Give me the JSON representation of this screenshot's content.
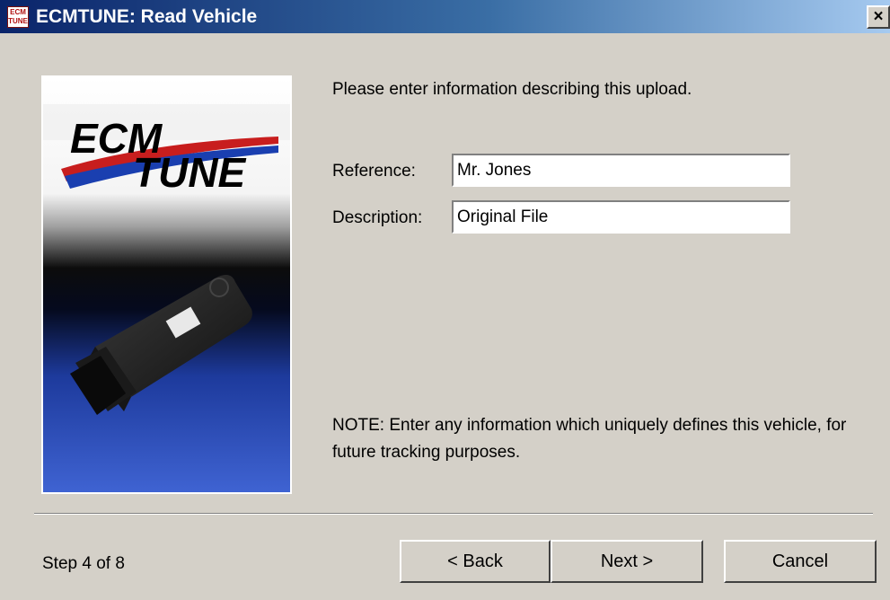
{
  "window": {
    "title": "ECMTUNE: Read Vehicle",
    "icon": "ecmtune-app-icon",
    "icon_text": "ECM TUNE",
    "close_label": "×"
  },
  "side_image": {
    "logo_text_1": "ECM",
    "logo_text_2": "TUNE",
    "subject": "obd2-interface-device-image"
  },
  "form": {
    "intro": "Please enter information describing this upload.",
    "reference_label": "Reference:",
    "reference_value": "Mr. Jones",
    "description_label": "Description:",
    "description_value": "Original File",
    "note": "NOTE:  Enter any information which uniquely defines this vehicle, for future tracking purposes."
  },
  "footer": {
    "step": "Step 4 of 8",
    "back_label": "< Back",
    "next_label": "Next >",
    "cancel_label": "Cancel"
  },
  "colors": {
    "title_gradient_start": "#0a246a",
    "title_gradient_end": "#a6caf0",
    "dialog_bg": "#d4d0c8",
    "logo_red": "#c81e1e",
    "logo_blue": "#1a3fb0"
  }
}
